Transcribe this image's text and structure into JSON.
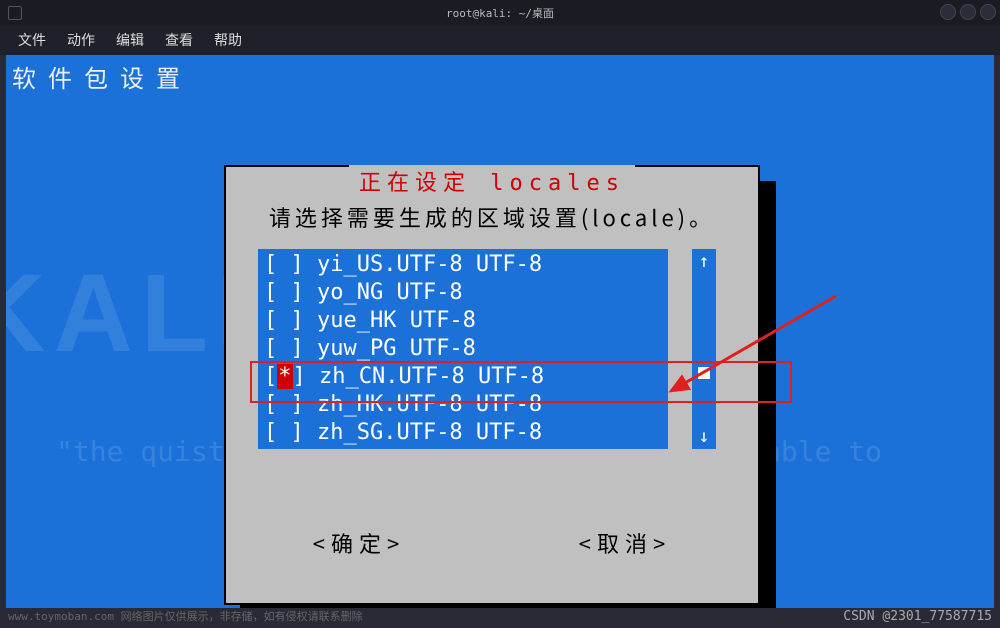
{
  "window": {
    "title": "root@kali: ~/桌面"
  },
  "menu": {
    "file": "文件",
    "action": "动作",
    "edit": "编辑",
    "view": "查看",
    "help": "帮助"
  },
  "pkg_header": "软件包设置",
  "dialog": {
    "title": "正在设定  locales",
    "prompt": "请选择需要生成的区域设置(locale)。",
    "ok": "<确定>",
    "cancel": "<取消>"
  },
  "locales": [
    {
      "checked": false,
      "label": "yi_US.UTF-8 UTF-8"
    },
    {
      "checked": false,
      "label": "yo_NG UTF-8"
    },
    {
      "checked": false,
      "label": "yue_HK UTF-8"
    },
    {
      "checked": false,
      "label": "yuw_PG UTF-8"
    },
    {
      "checked": true,
      "label": "zh_CN.UTF-8 UTF-8"
    },
    {
      "checked": false,
      "label": "zh_HK.UTF-8 UTF-8"
    },
    {
      "checked": false,
      "label": "zh_SG.UTF-8 UTF-8"
    }
  ],
  "scroll": {
    "up": "↑",
    "down": "↓"
  },
  "bg": {
    "big": "KALI  LINUX",
    "quote": "\"the quister you become, the more you are able to "
  },
  "footer": {
    "left": "www.toymoban.com 网络图片仅供展示，非存储，如有侵权请联系删除",
    "right": "CSDN @2301_77587715"
  }
}
